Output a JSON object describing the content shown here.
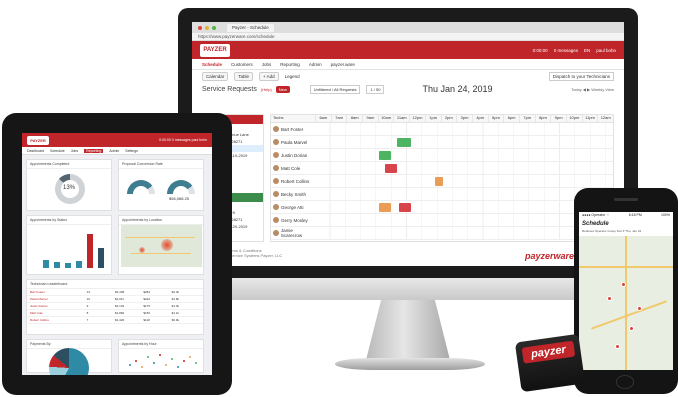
{
  "monitor": {
    "tab_title": "Payzer - Schedule",
    "address": "https://www.payzerware.com/schedule",
    "brand_logo": "PAYZER",
    "header_right": [
      "0:00:00",
      "0 messages",
      "EN",
      "paul bohn"
    ],
    "nav": [
      "Schedule",
      "Customers",
      "Jobs",
      "Reporting",
      "Admin",
      "payzer.ware"
    ],
    "toolbar": {
      "calendar": "Calendar",
      "table": "Table",
      "add": "+ Add",
      "legend": "Legend",
      "dispatch": "Dispatch to your Technicians"
    },
    "service_requests": {
      "title": "Service Requests",
      "tag": "(Help)",
      "badge": "New",
      "filter": "Unfiltered / All Requests",
      "count": "1 / 50"
    },
    "date": "Thu Jan 24, 2019",
    "tools": "Today  ◀ ▶  Weekly View",
    "requests": [
      {
        "header": "Bristol",
        "lines": [
          "Bi Day",
          "3740 Bear Avenue Lane",
          "Charlotte, NC 28271",
          "Bethesda, MD",
          "Created on 06-10-2019"
        ],
        "selected_index": 3,
        "color": "red"
      },
      {
        "header": "Assistance",
        "lines": [
          "Bruce Wayne",
          "6618 Sullivan Hl",
          "Charlotte, NC 28271",
          "Created on 06-20-2019"
        ],
        "color": "green"
      }
    ],
    "hours": [
      "6am",
      "7am",
      "8am",
      "9am",
      "10am",
      "11am",
      "12pm",
      "1pm",
      "2pm",
      "3pm",
      "4pm",
      "5pm",
      "6pm",
      "7pm",
      "8pm",
      "9pm",
      "10pm",
      "11pm",
      "12am"
    ],
    "technicians": [
      "Bart Foster",
      "Paula Marvel",
      "Justin Dorian",
      "Matt Cole",
      "Robert Collins",
      "Becky Smith",
      "George Atti",
      "Gerry Mosley",
      "Jamie Scarecrow"
    ],
    "footer": [
      "Marketplace | Terms & Conditions",
      "© 2019 Payzer Service Systems Payzer, LLC"
    ],
    "brand_footer": "payzerware"
  },
  "tablet": {
    "brand_logo": "PAYZER",
    "header_right": "0:00:00  0 messages  paul bohn",
    "nav": [
      "Dashboard",
      "Schedule",
      "Jobs",
      "Reporting",
      "Admin",
      "Settings"
    ],
    "cards": {
      "appointments": "Appointments Completed",
      "donut_value": "13%",
      "revenue": "Proposal Conversion Rate",
      "gauge_left": "",
      "gauge_right": "$56,088.25",
      "jobs_by_status": "Appointments by Status",
      "map": "Appointments by Location",
      "top_techs": "Technician Leaderboard",
      "payments": "Payments By",
      "scatter": "Appointments by Hour"
    },
    "tech_rows": [
      [
        "Bart Foster",
        "12",
        "$3,408",
        "$284",
        "$2.3k"
      ],
      [
        "Paula Marvel",
        "10",
        "$2,911",
        "$242",
        "$1.8k"
      ],
      [
        "Justin Dorian",
        "9",
        "$2,104",
        "$175",
        "$1.4k"
      ],
      [
        "Matt Cole",
        "8",
        "$1,882",
        "$156",
        "$1.1k"
      ],
      [
        "Robert Collins",
        "7",
        "$1,420",
        "$118",
        "$0.9k"
      ]
    ]
  },
  "phone": {
    "carrier": "●●●● Operator ⌔",
    "time": "6:18 PM",
    "battery": "100%",
    "title": "Schedule",
    "subtitle": "Retained Operator Group  Sort ▾  Thu, Jan 24"
  },
  "reader": {
    "label": "payzer"
  },
  "colors": {
    "brand_red": "#c0252a",
    "appt_green": "#4db562",
    "appt_orange": "#e99d56",
    "accent_teal": "#2f8aa6"
  }
}
